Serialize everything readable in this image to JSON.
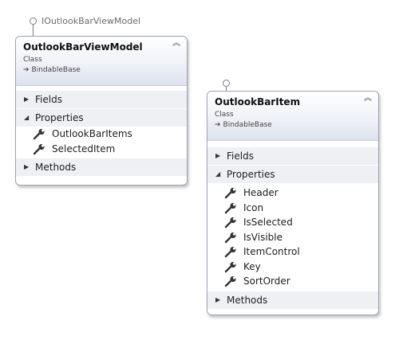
{
  "interface_label": "IOutlookBarViewModel",
  "boxes": [
    {
      "title": "OutlookBarViewModel",
      "kind": "Class",
      "base": "BindableBase",
      "sections": {
        "fields": "Fields",
        "properties": "Properties",
        "methods": "Methods"
      },
      "properties": [
        "OutlookBarItems",
        "SelectedItem"
      ]
    },
    {
      "title": "OutlookBarItem",
      "kind": "Class",
      "base": "BindableBase",
      "sections": {
        "fields": "Fields",
        "properties": "Properties",
        "methods": "Methods"
      },
      "properties": [
        "Header",
        "Icon",
        "IsSelected",
        "IsVisible",
        "ItemControl",
        "Key",
        "SortOrder"
      ]
    }
  ],
  "icons": {
    "property": "wrench-icon",
    "expand": "triangle-right-icon",
    "expanded": "triangle-down-icon",
    "collapse": "double-chevron-up-icon",
    "inheritance": "arrow-icon"
  },
  "colors": {
    "border": "#9aa4b6",
    "header_bottom": "#dde2ee",
    "section_shade": "#eef0f4"
  }
}
